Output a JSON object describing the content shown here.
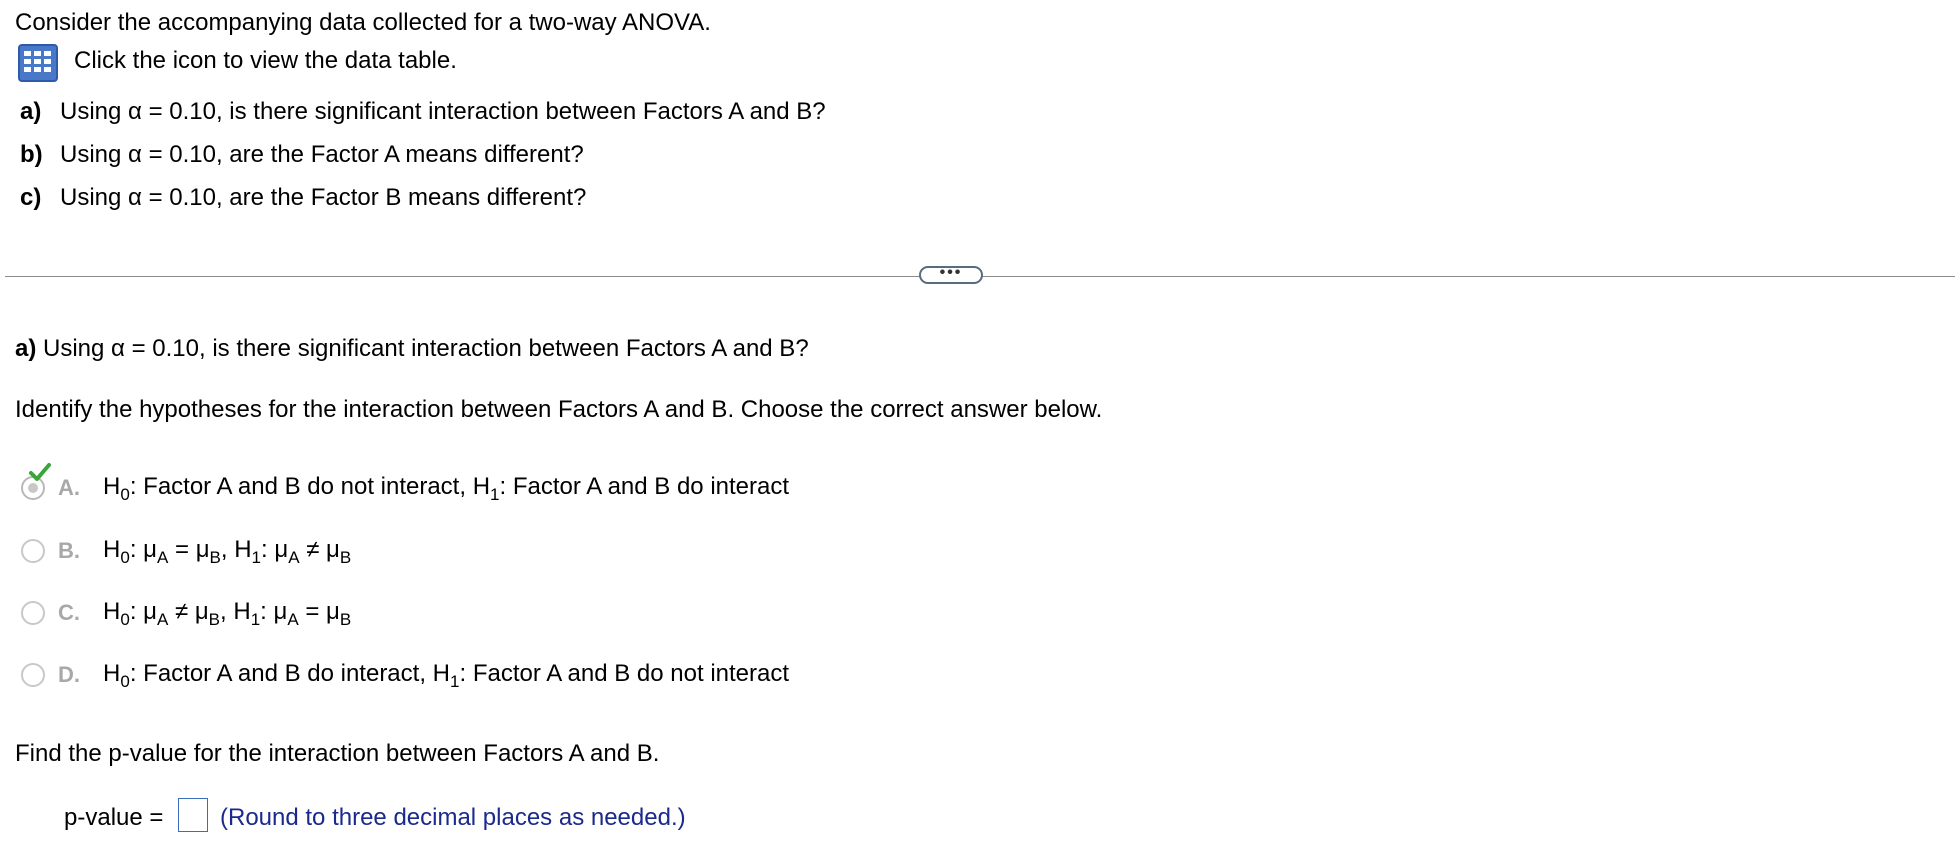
{
  "intro": "Consider the accompanying data collected for a two-way ANOVA.",
  "icon_label": "Click the icon to view the data table.",
  "questions": [
    {
      "letter": "a)",
      "text": "Using α = 0.10, is there significant interaction between Factors A and B?"
    },
    {
      "letter": "b)",
      "text": "Using α = 0.10, are the Factor A means different?"
    },
    {
      "letter": "c)",
      "text": "Using α = 0.10, are the Factor B means different?"
    }
  ],
  "ellipsis": "•••",
  "part_a": {
    "letter": "a)",
    "question": "Using α = 0.10, is there significant interaction between Factors A and B?",
    "instruction": "Identify the hypotheses for the interaction between Factors A and B. Choose the correct answer below."
  },
  "options": [
    {
      "letter": "A.",
      "selected": true,
      "h0": "Factor A and B do not interact,",
      "h1": "Factor A and B do interact"
    },
    {
      "letter": "B.",
      "selected": false,
      "h0_left": "μ",
      "h0_left_sub": "A",
      "h0_rel": "=",
      "h0_right": "μ",
      "h0_right_sub": "B",
      "h1_left": "μ",
      "h1_left_sub": "A",
      "h1_rel": "≠",
      "h1_right": "μ",
      "h1_right_sub": "B"
    },
    {
      "letter": "C.",
      "selected": false,
      "h0_left": "μ",
      "h0_left_sub": "A",
      "h0_rel": "≠",
      "h0_right": "μ",
      "h0_right_sub": "B",
      "h1_left": "μ",
      "h1_left_sub": "A",
      "h1_rel": "=",
      "h1_right": "μ",
      "h1_right_sub": "B"
    },
    {
      "letter": "D.",
      "selected": false,
      "h0": "Factor A and B do interact,",
      "h1": "Factor A and B do not interact"
    }
  ],
  "hyp": {
    "h": "H",
    "h0_sub": "0",
    "h1_sub": "1",
    "colon": ":"
  },
  "find_text": "Find the p-value for the interaction between Factors A and B.",
  "pvalue": {
    "label": "p-value =",
    "value": "",
    "hint": "(Round to three decimal places as needed.)"
  },
  "colors": {
    "check": "#3aa53a",
    "hint": "#1a2a8c",
    "icon": "#4a78c9"
  }
}
